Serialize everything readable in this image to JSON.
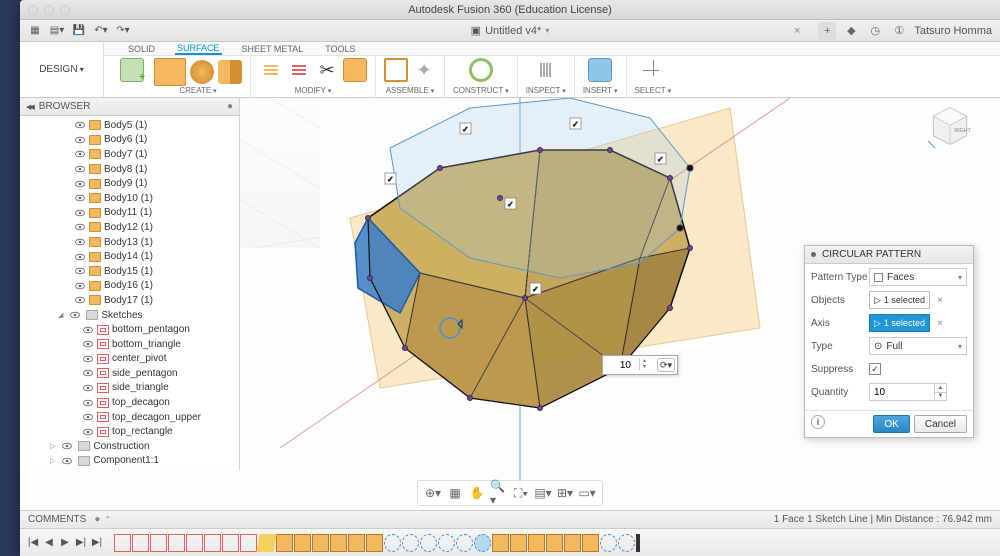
{
  "titlebar": {
    "title": "Autodesk Fusion 360 (Education License)"
  },
  "document": {
    "name": "Untitled v4*",
    "close_x": "×",
    "user": "Tatsuro Homma"
  },
  "ribbon": {
    "design_label": "DESIGN",
    "tabs": [
      "SOLID",
      "SURFACE",
      "SHEET METAL",
      "TOOLS"
    ],
    "active_tab": "SURFACE",
    "groups": {
      "create": "CREATE",
      "modify": "MODIFY",
      "assemble": "ASSEMBLE",
      "construct": "CONSTRUCT",
      "inspect": "INSPECT",
      "insert": "INSERT",
      "select": "SELECT"
    }
  },
  "browser": {
    "title": "BROWSER",
    "bodies": [
      "Body5 (1)",
      "Body6 (1)",
      "Body7 (1)",
      "Body8 (1)",
      "Body9 (1)",
      "Body10 (1)",
      "Body11 (1)",
      "Body12 (1)",
      "Body13 (1)",
      "Body14 (1)",
      "Body15 (1)",
      "Body16 (1)",
      "Body17 (1)"
    ],
    "sketches_group": "Sketches",
    "sketches": [
      "bottom_pentagon",
      "bottom_triangle",
      "center_pivot",
      "side_pentagon",
      "side_triangle",
      "top_decagon",
      "top_decagon_upper",
      "top_rectangle"
    ],
    "construction": "Construction",
    "component": "Component1:1"
  },
  "dialog": {
    "title": "CIRCULAR PATTERN",
    "rows": {
      "pattern_type": "Pattern Type",
      "pattern_type_val": "Faces",
      "objects": "Objects",
      "objects_val": "1 selected",
      "axis": "Axis",
      "axis_val": "1 selected",
      "type": "Type",
      "type_val": "Full",
      "suppress": "Suppress",
      "quantity": "Quantity",
      "quantity_val": "10"
    },
    "ok": "OK",
    "cancel": "Cancel"
  },
  "float_input": {
    "value": "10"
  },
  "statusbar": {
    "right": "1 Face 1 Sketch Line | Min Distance : 76.942 mm"
  },
  "comments": {
    "label": "COMMENTS"
  },
  "viewcube": {
    "face": "RIGHT"
  }
}
